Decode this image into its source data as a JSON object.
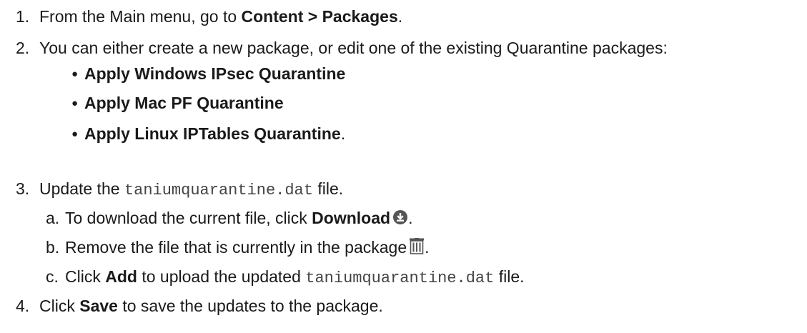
{
  "steps": [
    {
      "num": "1.",
      "pre": "From the Main menu, go to ",
      "bold": "Content > Packages",
      "post": "."
    },
    {
      "num": "2.",
      "text": "You can either create a new package, or edit one of the existing Quarantine packages:"
    },
    {
      "num": "3.",
      "pre": "Update the ",
      "code": "taniumquarantine.dat",
      "post": " file."
    },
    {
      "num": "4.",
      "pre": "Click ",
      "bold": "Save",
      "post": " to save the updates to the package."
    }
  ],
  "packages": [
    {
      "name": "Apply Windows IPsec Quarantine",
      "suffix": ""
    },
    {
      "name": "Apply Mac PF Quarantine",
      "suffix": ""
    },
    {
      "name": "Apply Linux IPTables Quarantine",
      "suffix": "."
    }
  ],
  "substeps": [
    {
      "letter": "a.",
      "pre": "To download the current file, click ",
      "bold": "Download",
      "icon": "download-icon",
      "post": "."
    },
    {
      "letter": "b.",
      "pre": "Remove the file that is currently in the package",
      "icon": "trash-icon",
      "post": "."
    },
    {
      "letter": "c.",
      "pre": "Click ",
      "bold": "Add",
      "mid": " to upload the updated ",
      "code": "taniumquarantine.dat",
      "post": " file."
    }
  ],
  "bullet_char": "●",
  "colors": {
    "text": "#1a1a1a",
    "code": "#444444",
    "icon": "#555555"
  }
}
